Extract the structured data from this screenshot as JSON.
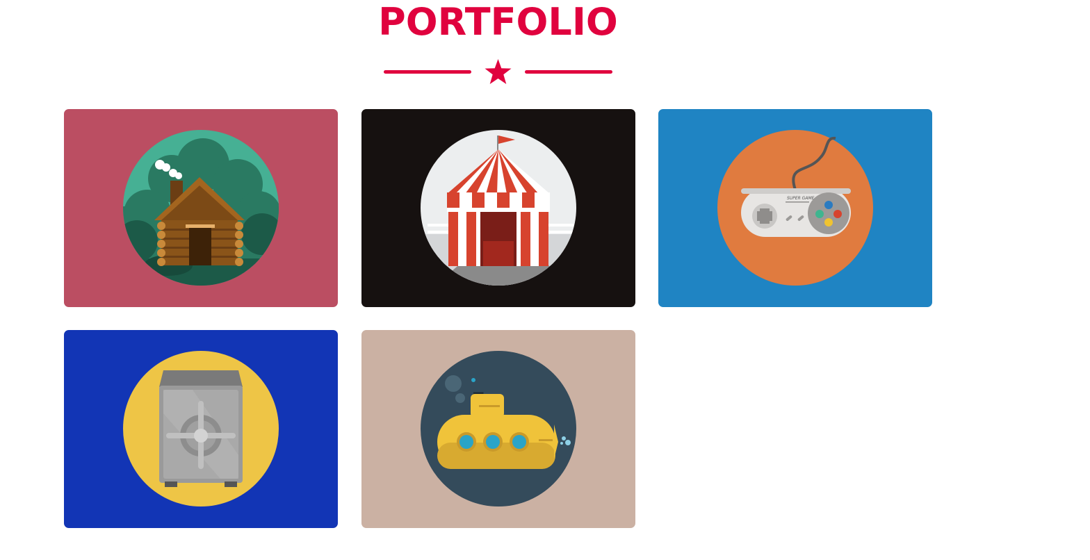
{
  "portfolio": {
    "title": "PORTFOLIO",
    "divider_icon": "star-icon",
    "accent_color": "#e0023e",
    "items": [
      {
        "name": "cabin",
        "icon": "log-cabin-icon",
        "background": "#bb4e62",
        "circle": "#46b094"
      },
      {
        "name": "circus",
        "icon": "circus-tent-icon",
        "background": "#161110",
        "circle": "#eceeef"
      },
      {
        "name": "game",
        "icon": "game-controller-icon",
        "background": "#1f84c3",
        "circle": "#e07b3f",
        "controller_text": "SUPER GAME"
      },
      {
        "name": "safe",
        "icon": "safe-icon",
        "background": "#1235b5",
        "circle": "#eec546"
      },
      {
        "name": "submarine",
        "icon": "submarine-icon",
        "background": "#cbb1a3",
        "circle": "#344b5b"
      }
    ]
  }
}
